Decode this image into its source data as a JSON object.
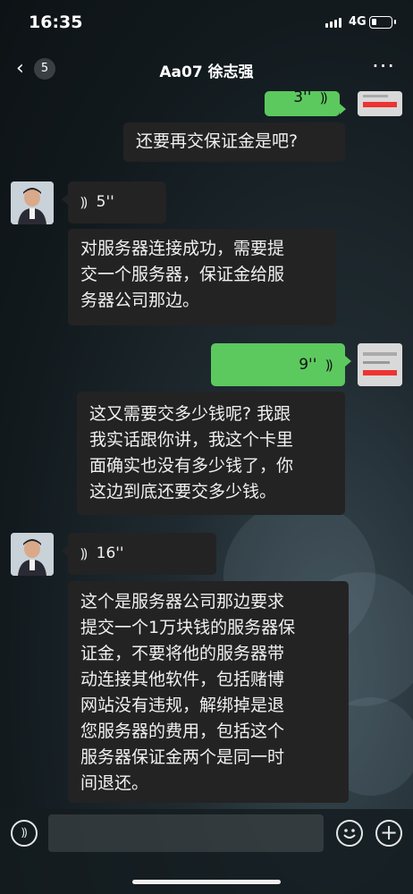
{
  "status_bar": {
    "time": "16:35",
    "network": "4G",
    "battery_level": 0.25
  },
  "nav": {
    "unread_count": "5",
    "title": "Aa07 徐志强"
  },
  "messages": {
    "m0_duration": "3''",
    "m1_text": "还要再交保证金是吧?",
    "m2_duration": "5''",
    "m3_lines": [
      "对服务器连接成功，需要提",
      "交一个服务器，保证金给服",
      "务器公司那边。"
    ],
    "m4_duration": "9''",
    "m5_lines": [
      "这又需要交多少钱呢? 我跟",
      "我实话跟你讲，我这个卡里",
      "面确实也没有多少钱了，你",
      "这边到底还要交多少钱。"
    ],
    "m6_duration": "16''",
    "m7_lines": [
      "这个是服务器公司那边要求",
      "提交一个1万块钱的服务器保",
      "证金，不要将他的服务器带",
      "动连接其他软件，包括赌博",
      "网站没有违规，解绑掉是退",
      "您服务器的费用，包括这个",
      "服务器保证金两个是同一时",
      "间退还。"
    ]
  },
  "colors": {
    "sent_bubble": "#5cc95f",
    "received_bubble": "#232323"
  },
  "icons": {
    "voice": "voice-wave-icon",
    "emoji": "emoji-icon",
    "add": "plus-icon",
    "back": "chevron-left-icon",
    "more": "more-dots-icon"
  }
}
